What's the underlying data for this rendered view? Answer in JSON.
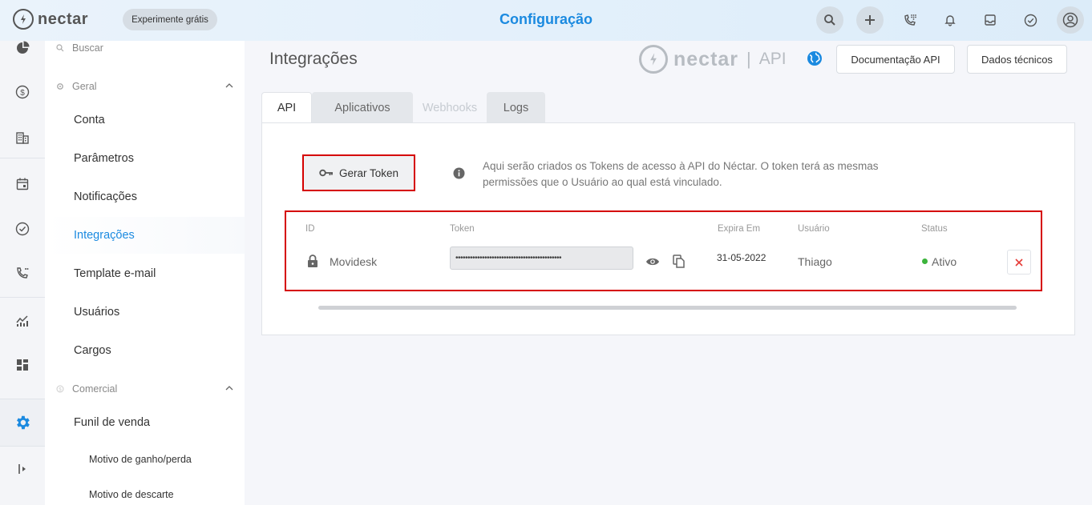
{
  "header": {
    "brand": "nectar",
    "trial_label": "Experimente grátis",
    "title": "Configuração",
    "icons": [
      "search-icon",
      "plus-icon",
      "phone-dialpad-icon",
      "bell-icon",
      "inbox-icon",
      "check-circle-icon",
      "user-avatar-icon"
    ]
  },
  "rail": {
    "icons": [
      "pie-chart-icon",
      "dollar-icon",
      "building-icon",
      "calendar-icon",
      "check-circle-icon",
      "phone-icon",
      "chart-up-icon",
      "dashboard-icon",
      "gear-icon",
      "collapse-icon"
    ],
    "active": "gear-icon"
  },
  "settings_nav": {
    "search_label": "Buscar",
    "group_geral": "Geral",
    "items_geral": [
      "Conta",
      "Parâmetros",
      "Notificações",
      "Integrações",
      "Template e-mail",
      "Usuários",
      "Cargos"
    ],
    "active_item": "Integrações",
    "group_comercial": "Comercial",
    "items_comercial": [
      "Funil de venda"
    ],
    "subitems_comercial": [
      "Motivo de ganho/perda",
      "Motivo de descarte"
    ]
  },
  "main": {
    "title": "Integrações",
    "brand_word": "nectar",
    "brand_separator": "|",
    "brand_suffix": "API",
    "doc_button": "Documentação API",
    "tech_button": "Dados técnicos",
    "tabs": [
      {
        "label": "API",
        "state": "active"
      },
      {
        "label": "Aplicativos",
        "state": "normal"
      },
      {
        "label": "Webhooks",
        "state": "disabled"
      },
      {
        "label": "Logs",
        "state": "normal"
      }
    ],
    "generate_button": "Gerar Token",
    "info_text": "Aqui serão criados os Tokens de acesso à API do Néctar. O token terá as mesmas permissões que o Usuário ao qual está vinculado.",
    "table": {
      "headers": {
        "id": "ID",
        "token": "Token",
        "expires": "Expira Em",
        "user": "Usuário",
        "status": "Status"
      },
      "rows": [
        {
          "id": "Movidesk",
          "token": "••••••••••••••••••••••••••••••••••••••••••••",
          "expires": "31-05-2022",
          "user": "Thiago",
          "status": "Ativo"
        }
      ]
    }
  },
  "colors": {
    "accent": "#1b8ae0",
    "highlight": "#d50000",
    "active_status": "#3cb43c"
  }
}
